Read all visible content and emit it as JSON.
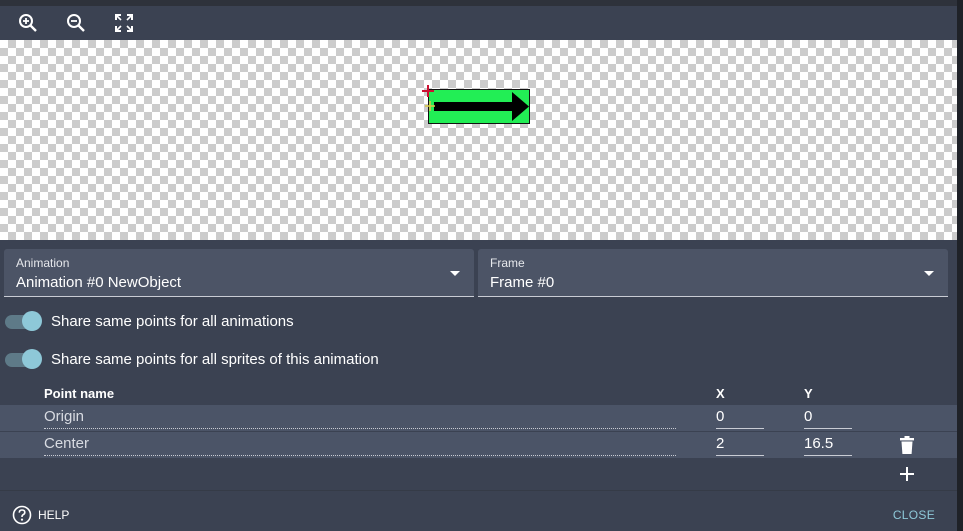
{
  "toolbar": {
    "zoom_in_icon": "zoom-in-icon",
    "zoom_out_icon": "zoom-out-icon",
    "fit_icon": "fullscreen-icon"
  },
  "canvas": {
    "background": "checkerboard",
    "sprite_color": "#22ee55"
  },
  "animation_select": {
    "label": "Animation",
    "value": "Animation #0 NewObject"
  },
  "frame_select": {
    "label": "Frame",
    "value": "Frame #0"
  },
  "toggles": [
    {
      "label": "Share same points for all animations",
      "checked": true
    },
    {
      "label": "Share same points for all sprites of this animation",
      "checked": true
    }
  ],
  "points_table": {
    "headers": {
      "name": "Point name",
      "x": "X",
      "y": "Y"
    },
    "rows": [
      {
        "name": "Origin",
        "x": "0",
        "y": "0",
        "deletable": false
      },
      {
        "name": "Center",
        "x": "2",
        "y": "16.5",
        "deletable": true
      }
    ]
  },
  "footer": {
    "help_label": "HELP",
    "close_label": "CLOSE"
  },
  "colors": {
    "accent": "#8ec8d8",
    "panel": "#3b4252",
    "field": "#4c5466"
  }
}
